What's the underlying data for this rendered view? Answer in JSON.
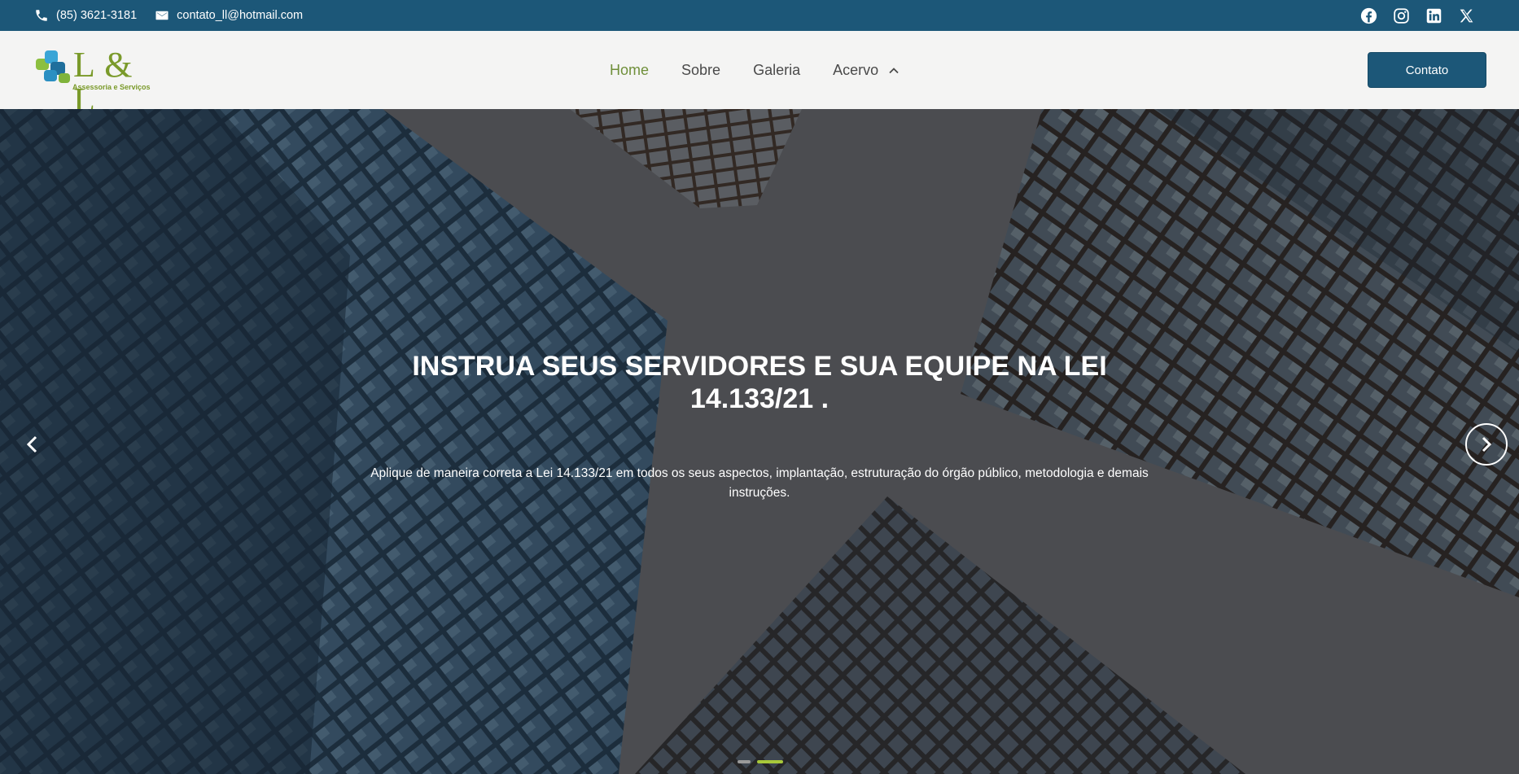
{
  "topbar": {
    "phone": "(85) 3621-3181",
    "email": "contato_ll@hotmail.com",
    "social": [
      "facebook-icon",
      "instagram-icon",
      "linkedin-icon",
      "x-twitter-icon"
    ]
  },
  "header": {
    "logo_text": "L & L",
    "logo_subtitle": "Assessoria e Serviços",
    "nav": {
      "home": "Home",
      "sobre": "Sobre",
      "galeria": "Galeria",
      "acervo": "Acervo"
    },
    "cta_label": "Contato"
  },
  "hero": {
    "title": "INSTRUA SEUS SERVIDORES E SUA EQUIPE NA LEI 14.133/21 .",
    "text": "Aplique de maneira correta a Lei 14.133/21 em todos os seus aspectos, implantação, estruturação do órgão público, metodologia e demais instruções.",
    "active_slide": 2,
    "slide_count": 2
  },
  "colors": {
    "primary": "#1c5778",
    "accent_green": "#6f8f3a",
    "dot_active": "#a8c83a",
    "dot_inactive": "#9a9a9a"
  }
}
